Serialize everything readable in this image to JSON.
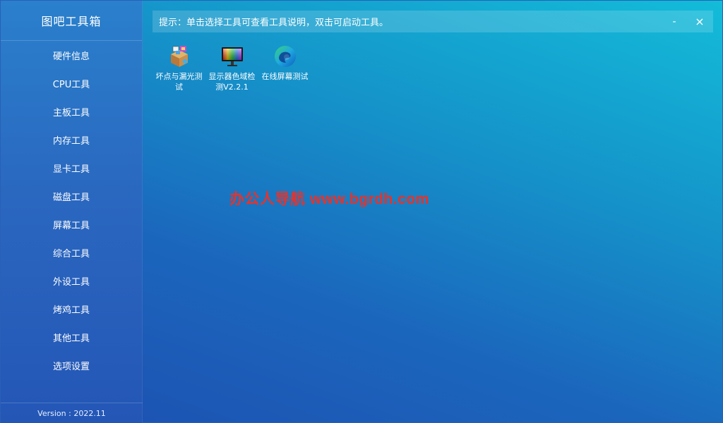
{
  "app": {
    "title": "图吧工具箱",
    "version": "Version : 2022.11"
  },
  "sidebar": {
    "items": [
      {
        "label": "硬件信息"
      },
      {
        "label": "CPU工具"
      },
      {
        "label": "主板工具"
      },
      {
        "label": "内存工具"
      },
      {
        "label": "显卡工具"
      },
      {
        "label": "磁盘工具"
      },
      {
        "label": "屏幕工具"
      },
      {
        "label": "综合工具"
      },
      {
        "label": "外设工具"
      },
      {
        "label": "烤鸡工具"
      },
      {
        "label": "其他工具"
      },
      {
        "label": "选项设置"
      }
    ]
  },
  "hint": {
    "text": "提示：单击选择工具可查看工具说明，双击可启动工具。"
  },
  "window_controls": {
    "minimize": "-",
    "close": "×"
  },
  "tools": [
    {
      "label": "坏点与漏光测试",
      "icon": "box-package-icon"
    },
    {
      "label": "显示器色域检测V2.2.1",
      "icon": "monitor-color-icon"
    },
    {
      "label": "在线屏幕测试",
      "icon": "edge-browser-icon"
    }
  ],
  "watermark": {
    "text": "办公人导航 www.bgrdh.com"
  },
  "colors": {
    "watermark": "#e8322a",
    "text": "#ffffff"
  }
}
